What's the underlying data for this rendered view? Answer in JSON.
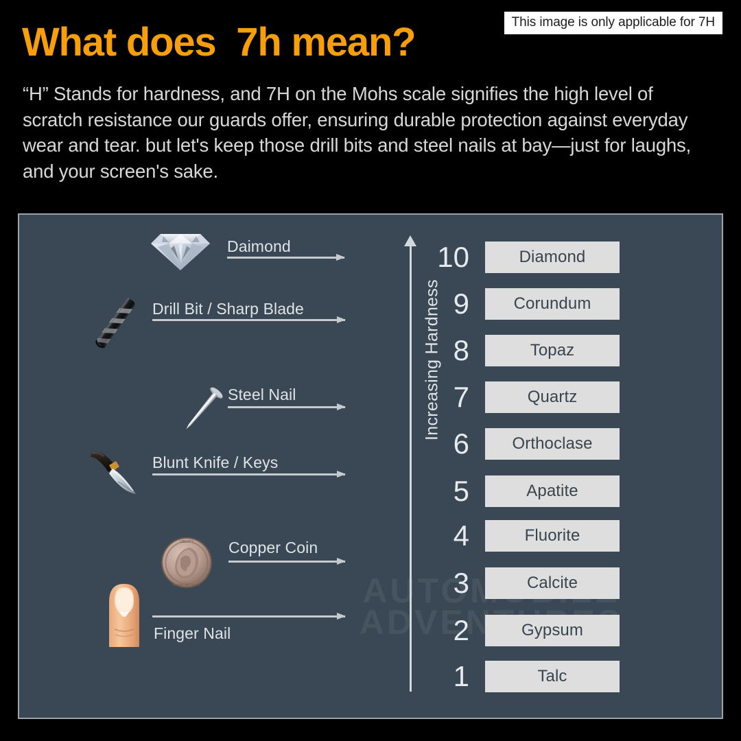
{
  "badge": {
    "text": "This image is only applicable for 7H"
  },
  "headline": {
    "text": "What does  7h mean?"
  },
  "paragraph": {
    "text": "“H” Stands for hardness, and 7H on the Mohs scale signifies the high level of scratch resistance our guards offer, ensuring durable protection against everyday wear and tear. but let's keep those drill bits and steel nails at bay—just for laughs, and your screen's sake."
  },
  "panel": {
    "watermark": "AUTOMOBILE ADVENTURES",
    "axis_caption": "Increasing Hardness"
  },
  "colors": {
    "accent_orange": "#F89E09",
    "panel_background": "#3a4855",
    "panel_border": "#9aa3ab",
    "bar_fill": "#dedede",
    "bar_text": "#38454f",
    "body_text": "#d8d8d8",
    "page_background": "#000000"
  },
  "scratch_tools": [
    {
      "label": "Daimond",
      "icon": "diamond-icon"
    },
    {
      "label": "Drill Bit / Sharp Blade",
      "icon": "drill-bit-icon"
    },
    {
      "label": "Steel Nail",
      "icon": "steel-nail-icon"
    },
    {
      "label": "Blunt Knife / Keys",
      "icon": "knife-icon"
    },
    {
      "label": "Copper Coin",
      "icon": "coin-icon"
    },
    {
      "label": "Finger Nail",
      "icon": "finger-nail-icon"
    }
  ],
  "chart_data": {
    "type": "bar",
    "title": "Mohs Hardness Scale",
    "xlabel": "",
    "ylabel": "Increasing Hardness",
    "ylim": [
      1,
      10
    ],
    "grid": false,
    "legend": "none",
    "orientation": "horizontal",
    "categories": [
      "Talc",
      "Gypsum",
      "Calcite",
      "Fluorite",
      "Apatite",
      "Orthoclase",
      "Quartz",
      "Topaz",
      "Corundum",
      "Diamond"
    ],
    "values": [
      1,
      2,
      3,
      4,
      5,
      6,
      7,
      8,
      9,
      10
    ],
    "rows": [
      {
        "value": "10",
        "mineral": "Diamond"
      },
      {
        "value": "9",
        "mineral": "Corundum"
      },
      {
        "value": "8",
        "mineral": "Topaz"
      },
      {
        "value": "7",
        "mineral": "Quartz"
      },
      {
        "value": "6",
        "mineral": "Orthoclase"
      },
      {
        "value": "5",
        "mineral": "Apatite"
      },
      {
        "value": "4",
        "mineral": "Fluorite"
      },
      {
        "value": "3",
        "mineral": "Calcite"
      },
      {
        "value": "2",
        "mineral": "Gypsum"
      },
      {
        "value": "1",
        "mineral": "Talc"
      }
    ],
    "annotations": [
      {
        "label": "Daimond",
        "points_to": "10"
      },
      {
        "label": "Drill Bit / Sharp Blade",
        "points_to": "8-9"
      },
      {
        "label": "Steel Nail",
        "points_to": "6-7"
      },
      {
        "label": "Blunt Knife / Keys",
        "points_to": "5-6"
      },
      {
        "label": "Copper Coin",
        "points_to": "3"
      },
      {
        "label": "Finger Nail",
        "points_to": "2"
      }
    ]
  }
}
